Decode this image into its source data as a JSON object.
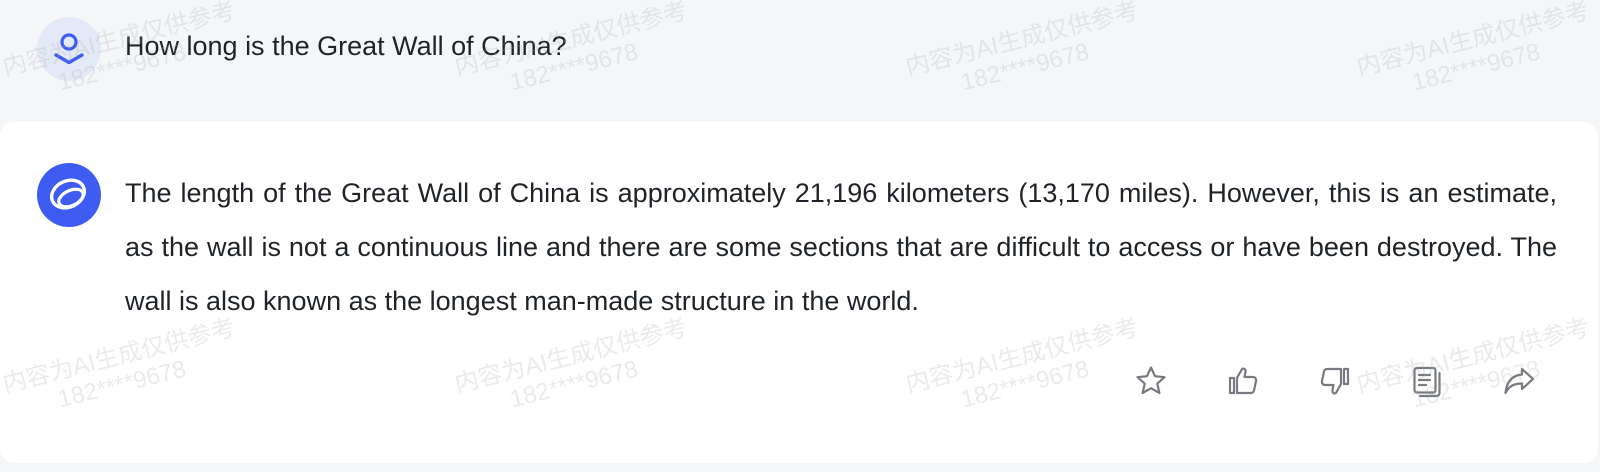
{
  "user_message": {
    "text": "How long is the Great Wall of China?"
  },
  "assistant_message": {
    "text": "The length of the Great Wall of China is approximately 21,196 kilometers (13,170 miles). However, this is an estimate, as the wall is not a continuous line and there are some sections that are difficult to access or have been destroyed. The wall is also known as the longest man-made structure in the world."
  },
  "actions": {
    "items": [
      {
        "name": "favorite",
        "icon": "star-icon"
      },
      {
        "name": "like",
        "icon": "thumbs-up-icon"
      },
      {
        "name": "dislike",
        "icon": "thumbs-down-icon"
      },
      {
        "name": "copy",
        "icon": "copy-icon"
      },
      {
        "name": "share",
        "icon": "share-arrow-icon"
      }
    ]
  },
  "watermark": {
    "line1": "内容为AI生成仅供参考",
    "line2": "182****9678"
  },
  "colors": {
    "page_background": "#f5f6f8",
    "card_background": "#ffffff",
    "brand_blue": "#3e5cf2",
    "user_avatar_bg": "#e4e9f7",
    "icon_gray": "#777a80"
  }
}
